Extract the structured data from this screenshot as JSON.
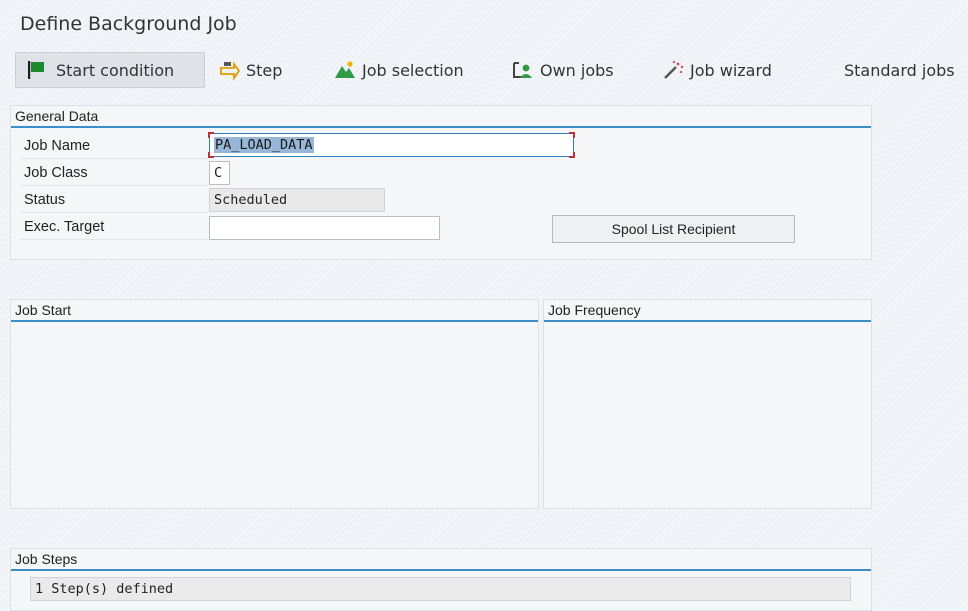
{
  "window": {
    "title": "Define Background Job"
  },
  "toolbar": {
    "start_condition": "Start condition",
    "step": "Step",
    "job_selection": "Job selection",
    "own_jobs": "Own jobs",
    "job_wizard": "Job wizard",
    "standard_jobs": "Standard jobs"
  },
  "general_data": {
    "title": "General Data",
    "job_name_label": "Job Name",
    "job_name_value": "PA_LOAD_DATA",
    "job_class_label": "Job Class",
    "job_class_value": "C",
    "status_label": "Status",
    "status_value": "Scheduled",
    "exec_target_label": "Exec. Target",
    "exec_target_value": "",
    "spool_button": "Spool List Recipient"
  },
  "job_start": {
    "title": "Job Start"
  },
  "job_frequency": {
    "title": "Job Frequency"
  },
  "job_steps": {
    "title": "Job Steps",
    "value": "1 Step(s) defined"
  },
  "colors": {
    "accent": "#3c8ec8",
    "selection": "#97b6d8",
    "focus_corner": "#c0313b"
  }
}
